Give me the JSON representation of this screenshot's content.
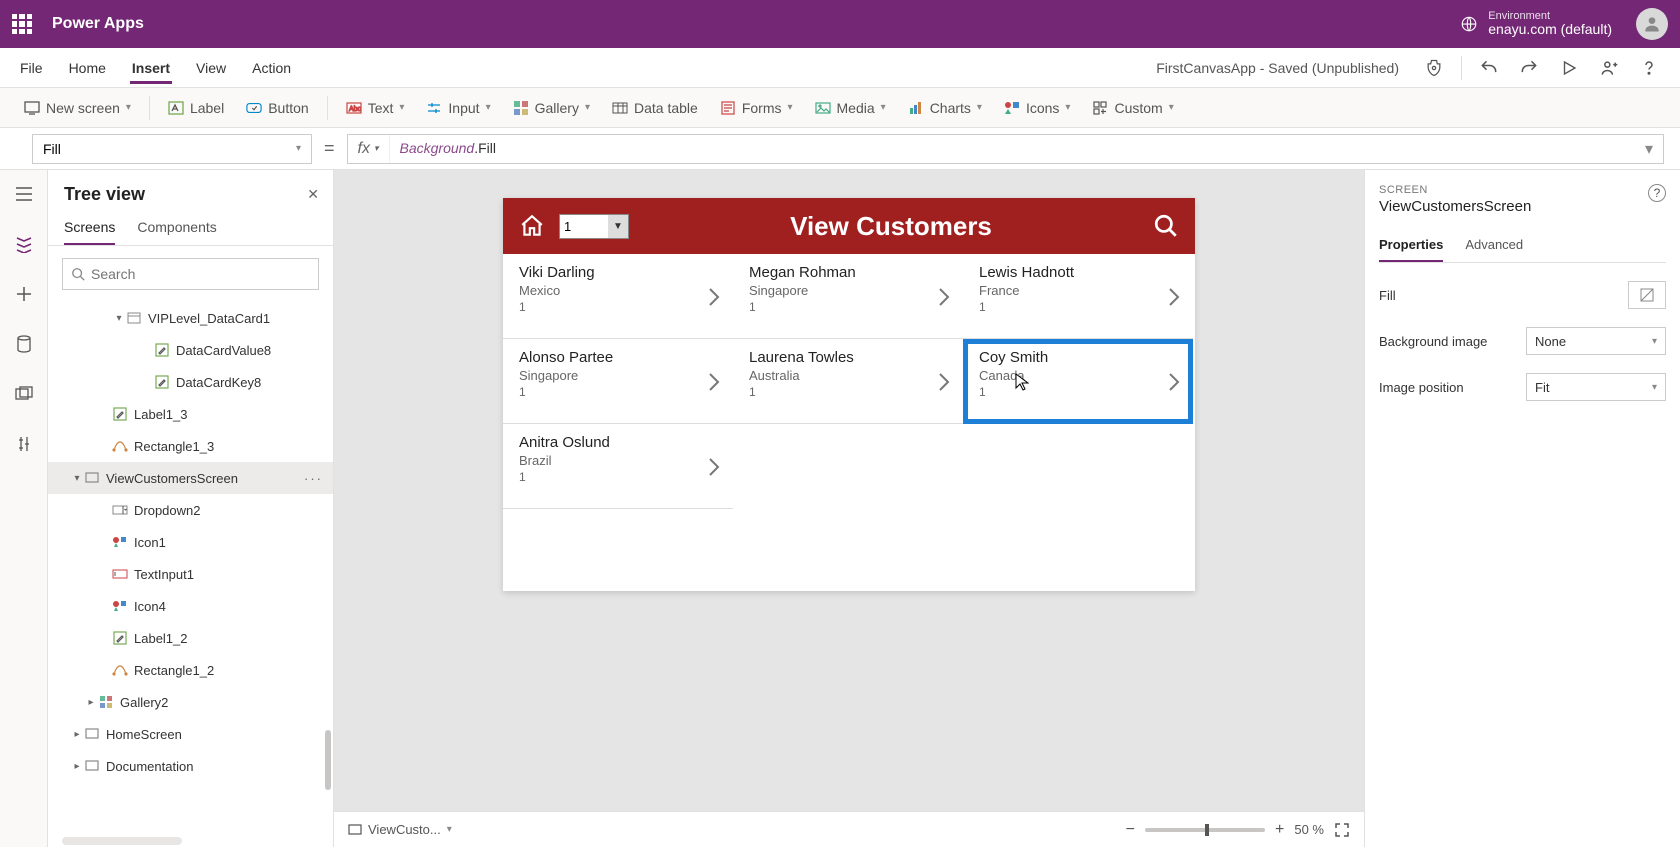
{
  "topbar": {
    "app_title": "Power Apps",
    "env_label": "Environment",
    "env_name": "enayu.com (default)"
  },
  "menubar": {
    "items": [
      "File",
      "Home",
      "Insert",
      "View",
      "Action"
    ],
    "active_index": 2,
    "doc_title": "FirstCanvasApp - Saved (Unpublished)"
  },
  "ribbon": {
    "items": [
      "New screen",
      "Label",
      "Button",
      "Text",
      "Input",
      "Gallery",
      "Data table",
      "Forms",
      "Media",
      "Charts",
      "Icons",
      "Custom"
    ]
  },
  "formula": {
    "property": "Fill",
    "fx": "fx",
    "expr_part1": "Background",
    "expr_part2": ".Fill"
  },
  "tree": {
    "title": "Tree view",
    "tabs": [
      "Screens",
      "Components"
    ],
    "active_tab": 0,
    "search_placeholder": "Search",
    "rows": [
      {
        "indent": 4,
        "expand": "v",
        "icon": "card",
        "label": "VIPLevel_DataCard1"
      },
      {
        "indent": 6,
        "expand": "",
        "icon": "pen",
        "label": "DataCardValue8"
      },
      {
        "indent": 6,
        "expand": "",
        "icon": "pen",
        "label": "DataCardKey8"
      },
      {
        "indent": 3,
        "expand": "",
        "icon": "pen",
        "label": "Label1_3"
      },
      {
        "indent": 3,
        "expand": "",
        "icon": "rect",
        "label": "Rectangle1_3"
      },
      {
        "indent": 1,
        "expand": "v",
        "icon": "screen",
        "label": "ViewCustomersScreen",
        "selected": true,
        "dots": true
      },
      {
        "indent": 3,
        "expand": "",
        "icon": "dd",
        "label": "Dropdown2"
      },
      {
        "indent": 3,
        "expand": "",
        "icon": "iconc",
        "label": "Icon1"
      },
      {
        "indent": 3,
        "expand": "",
        "icon": "input",
        "label": "TextInput1"
      },
      {
        "indent": 3,
        "expand": "",
        "icon": "iconc",
        "label": "Icon4"
      },
      {
        "indent": 3,
        "expand": "",
        "icon": "pen",
        "label": "Label1_2"
      },
      {
        "indent": 3,
        "expand": "",
        "icon": "rect",
        "label": "Rectangle1_2"
      },
      {
        "indent": 2,
        "expand": ">",
        "icon": "gal",
        "label": "Gallery2"
      },
      {
        "indent": 1,
        "expand": ">",
        "icon": "screen",
        "label": "HomeScreen"
      },
      {
        "indent": 1,
        "expand": ">",
        "icon": "screen",
        "label": "Documentation"
      }
    ]
  },
  "canvas": {
    "title": "View Customers",
    "dropdown_value": "1",
    "customers": [
      {
        "name": "Viki  Darling",
        "country": "Mexico",
        "level": "1"
      },
      {
        "name": "Megan  Rohman",
        "country": "Singapore",
        "level": "1"
      },
      {
        "name": "Lewis  Hadnott",
        "country": "France",
        "level": "1"
      },
      {
        "name": "Alonso  Partee",
        "country": "Singapore",
        "level": "1"
      },
      {
        "name": "Laurena  Towles",
        "country": "Australia",
        "level": "1"
      },
      {
        "name": "Coy  Smith",
        "country": "Canada",
        "level": "1",
        "selected": true
      },
      {
        "name": "Anitra  Oslund",
        "country": "Brazil",
        "level": "1"
      }
    ]
  },
  "status": {
    "breadcrumb": "ViewCusto...",
    "zoom": "50  %"
  },
  "rightpanel": {
    "category": "SCREEN",
    "name": "ViewCustomersScreen",
    "tabs": [
      "Properties",
      "Advanced"
    ],
    "active_tab": 0,
    "rows": [
      {
        "label": "Fill",
        "type": "fill"
      },
      {
        "label": "Background image",
        "type": "select",
        "value": "None"
      },
      {
        "label": "Image position",
        "type": "select",
        "value": "Fit"
      }
    ]
  }
}
